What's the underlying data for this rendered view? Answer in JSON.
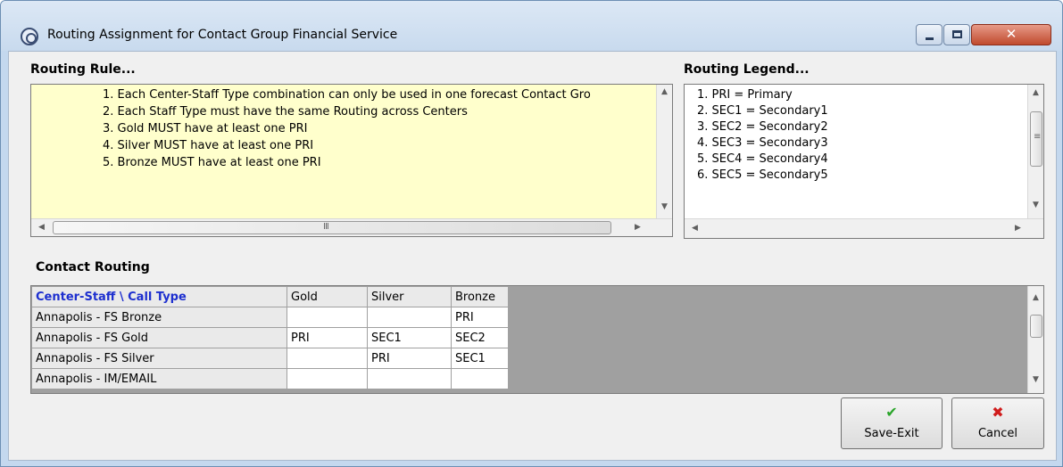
{
  "window": {
    "title": "Routing Assignment for Contact Group Financial Service",
    "icon": "app-gear-icon"
  },
  "colors": {
    "rule_background": "#ffffcc",
    "grid_header_text": "#1d2fcf",
    "save_icon": "#2aa52a",
    "cancel_icon": "#d01c1c",
    "grid_empty_area": "#a0a0a0"
  },
  "routing_rule": {
    "label": "Routing Rule...",
    "items": [
      "1. Each Center-Staff Type combination can only be used in one forecast Contact Gro",
      "2. Each Staff Type must have the same Routing across Centers",
      "3. Gold MUST have at least one PRI",
      "4. Silver MUST have at least one PRI",
      "5. Bronze MUST have at least one PRI"
    ],
    "hscroll_grip": "III"
  },
  "routing_legend": {
    "label": "Routing Legend...",
    "items": [
      "1. PRI = Primary",
      "2. SEC1 = Secondary1",
      "3. SEC2 = Secondary2",
      "4. SEC3 = Secondary3",
      "5. SEC4 = Secondary4",
      "6. SEC5 = Secondary5"
    ]
  },
  "contact_routing": {
    "label": "Contact Routing",
    "columns": [
      "Center-Staff \\ Call Type",
      "Gold",
      "Silver",
      "Bronze"
    ],
    "rows": [
      [
        "Annapolis - FS Bronze",
        "",
        "",
        "PRI"
      ],
      [
        "Annapolis - FS Gold",
        "PRI",
        "SEC1",
        "SEC2"
      ],
      [
        "Annapolis - FS Silver",
        "",
        "PRI",
        "SEC1"
      ],
      [
        "Annapolis - IM/EMAIL",
        "",
        "",
        ""
      ]
    ]
  },
  "buttons": {
    "save_exit": "Save-Exit",
    "cancel": "Cancel"
  }
}
